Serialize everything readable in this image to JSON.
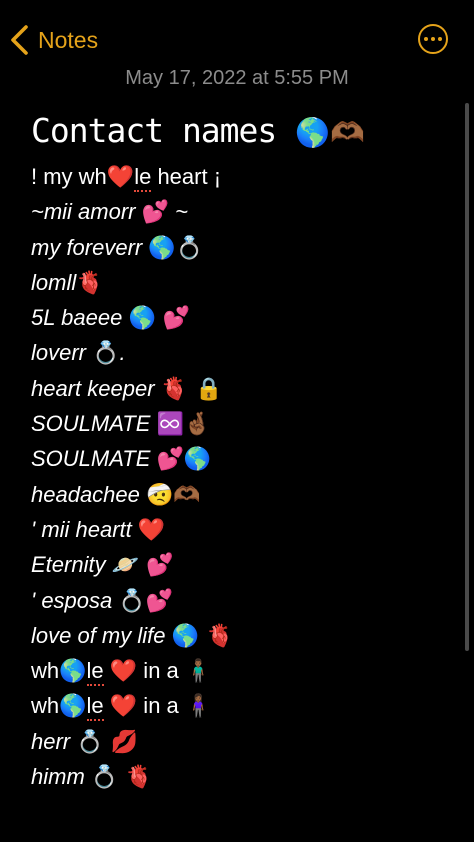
{
  "nav": {
    "back_label": "Notes"
  },
  "note": {
    "date": "May 17, 2022 at 5:55 PM",
    "title": "Contact names",
    "title_emoji": "🌎🫶🏾",
    "lines": [
      {
        "upright": true,
        "segments": [
          {
            "t": "! my wh"
          },
          {
            "t": "❤️",
            "e": 1
          },
          {
            "t": "le",
            "s": 1
          },
          {
            "t": " heart ¡"
          }
        ]
      },
      {
        "upright": false,
        "segments": [
          {
            "t": "~mii amorr "
          },
          {
            "t": "💕",
            "e": 1
          },
          {
            "t": " ~"
          }
        ]
      },
      {
        "upright": false,
        "segments": [
          {
            "t": "my foreverr "
          },
          {
            "t": "🌎💍",
            "e": 1
          }
        ]
      },
      {
        "upright": false,
        "segments": [
          {
            "t": "lomll"
          },
          {
            "t": "🫀",
            "e": 1
          }
        ]
      },
      {
        "upright": false,
        "segments": [
          {
            "t": "5L baeee "
          },
          {
            "t": "🌎 💕",
            "e": 1
          }
        ]
      },
      {
        "upright": false,
        "segments": [
          {
            "t": "loverr "
          },
          {
            "t": "💍",
            "e": 1
          },
          {
            "t": "."
          }
        ]
      },
      {
        "upright": false,
        "segments": [
          {
            "t": "heart keeper "
          },
          {
            "t": "🫀 🔒",
            "e": 1
          }
        ]
      },
      {
        "upright": false,
        "segments": [
          {
            "t": "SOULMATE "
          },
          {
            "t": "♾️🤞🏾",
            "e": 1
          }
        ]
      },
      {
        "upright": false,
        "segments": [
          {
            "t": "SOULMATE "
          },
          {
            "t": "💕🌎",
            "e": 1
          }
        ]
      },
      {
        "upright": false,
        "segments": [
          {
            "t": "headachee "
          },
          {
            "t": "🤕🫶🏾",
            "e": 1
          }
        ]
      },
      {
        "upright": false,
        "segments": [
          {
            "t": "' mii heartt "
          },
          {
            "t": "❤️",
            "e": 1
          }
        ]
      },
      {
        "upright": false,
        "segments": [
          {
            "t": "Eternity "
          },
          {
            "t": "🪐 💕",
            "e": 1
          }
        ]
      },
      {
        "upright": false,
        "segments": [
          {
            "t": "' esposa "
          },
          {
            "t": "💍💕",
            "e": 1
          }
        ]
      },
      {
        "upright": false,
        "segments": [
          {
            "t": "love of my life "
          },
          {
            "t": "🌎 🫀",
            "e": 1
          }
        ]
      },
      {
        "upright": true,
        "segments": [
          {
            "t": "wh"
          },
          {
            "t": "🌎",
            "e": 1
          },
          {
            "t": "le",
            "s": 1
          },
          {
            "t": " "
          },
          {
            "t": "❤️",
            "e": 1
          },
          {
            "t": "  in a "
          },
          {
            "t": "🧍🏾‍♂️",
            "e": 1
          }
        ]
      },
      {
        "upright": true,
        "segments": [
          {
            "t": "wh"
          },
          {
            "t": "🌎",
            "e": 1
          },
          {
            "t": "le",
            "s": 1
          },
          {
            "t": " "
          },
          {
            "t": "❤️",
            "e": 1
          },
          {
            "t": "  in a "
          },
          {
            "t": "🧍🏾‍♀️",
            "e": 1
          }
        ]
      },
      {
        "upright": false,
        "segments": [
          {
            "t": "herr "
          },
          {
            "t": "💍 💋",
            "e": 1
          }
        ]
      },
      {
        "upright": false,
        "segments": [
          {
            "t": "himm "
          },
          {
            "t": "💍 🫀",
            "e": 1
          }
        ]
      }
    ]
  },
  "colors": {
    "accent": "#e5a31a",
    "date": "#8c8c8c",
    "spellcheck": "#e24a3b"
  },
  "icons": {
    "back": "chevron-left-icon",
    "more": "ellipsis-circle-icon"
  }
}
